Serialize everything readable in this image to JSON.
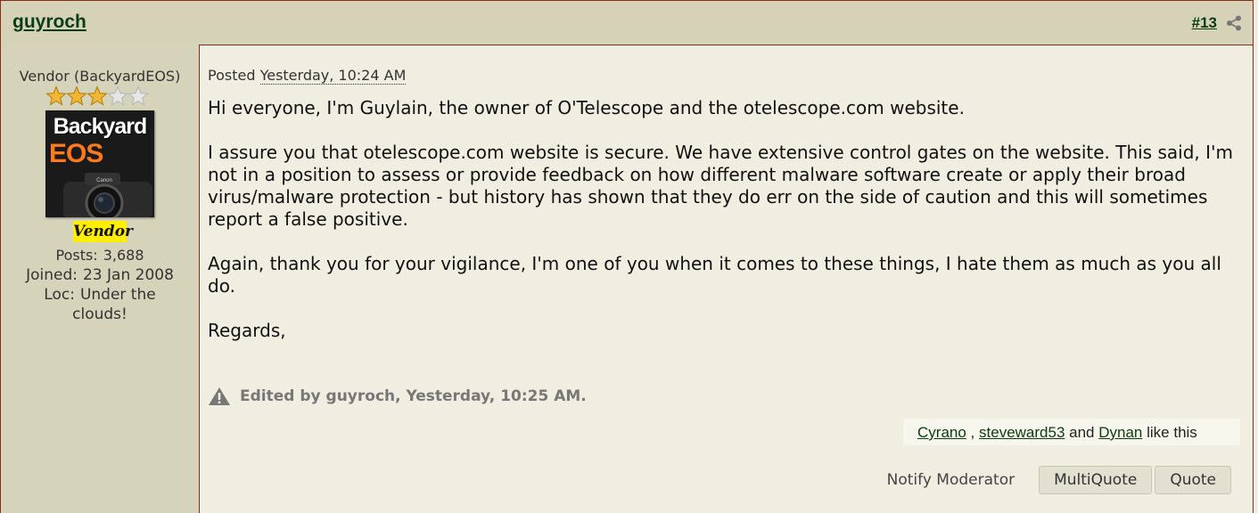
{
  "header": {
    "author": "guyroch",
    "post_number": "#13",
    "share_icon": "share-icon"
  },
  "sidebar": {
    "user_title": "Vendor (BackyardEOS)",
    "stars": {
      "filled": 3,
      "total": 5
    },
    "avatar": {
      "line1": "Backyard",
      "line2": "EOS"
    },
    "badge": "Vendor",
    "stats": [
      {
        "label": "Posts:",
        "value": "3,688"
      },
      {
        "label": "Joined:",
        "value": "23 Jan 2008"
      },
      {
        "label": "Loc:",
        "value": "Under the clouds!"
      }
    ]
  },
  "post": {
    "posted_label": "Posted",
    "posted_time": "Yesterday, 10:24 AM",
    "paragraphs": [
      "Hi everyone, I'm Guylain, the owner of O'Telescope and the otelescope.com website.",
      "I assure you that otelescope.com website is secure. We have extensive control gates on the website. This said, I'm not in a position to assess or provide feedback on how different malware software create or apply their broad virus/malware protection - but history has shown that they do err on the side of caution and this will sometimes report a false positive.",
      "Again, thank you for your vigilance, I'm one of you when it comes to these things, I hate them as much as you all do.",
      "Regards,"
    ],
    "edited_note": "Edited by guyroch, Yesterday, 10:25 AM.",
    "likes": {
      "users": [
        "Cyrano",
        "steveward53",
        "Dynan"
      ],
      "sep1": ",",
      "sep2": "and",
      "suffix": "like this"
    }
  },
  "actions": {
    "notify": "Notify Moderator",
    "multiquote": "MultiQuote",
    "quote": "Quote"
  },
  "colors": {
    "header_bg": "#d5d2b8",
    "link_green": "#0b3d13",
    "border_red": "#8a2b20",
    "badge_yellow": "#ffee00"
  }
}
